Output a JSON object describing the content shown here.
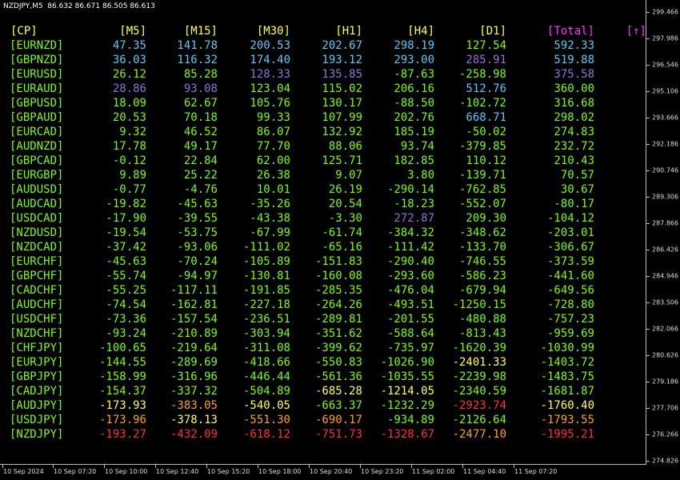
{
  "chart_title": "NZDJPY,M5  86.632 86.671 86.505 86.613",
  "price_axis": [
    "299.466",
    "297.986",
    "296.546",
    "295.106",
    "293.666",
    "292.186",
    "290.746",
    "289.306",
    "287.866",
    "286.426",
    "284.946",
    "283.506",
    "282.066",
    "280.626",
    "279.186",
    "277.706",
    "276.266",
    "274.826"
  ],
  "time_axis": [
    "10 Sep 2024",
    "10 Sep 07:20",
    "10 Sep 10:00",
    "10 Sep 12:40",
    "10 Sep 15:20",
    "10 Sep 18:00",
    "10 Sep 20:40",
    "10 Sep 23:20",
    "11 Sep 02:00",
    "11 Sep 04:40",
    "11 Sep 07:20"
  ],
  "table": {
    "headers": {
      "pair": "[CP]",
      "m5": "[M5]",
      "m15": "[M15]",
      "m30": "[M30]",
      "h1": "[H1]",
      "h4": "[H4]",
      "d1": "[D1]",
      "total": "[Total]",
      "sort": "[↑]"
    },
    "rows": [
      {
        "pair": "[EURNZD]",
        "values": [
          "47.35",
          "141.78",
          "200.53",
          "202.67",
          "298.19",
          "127.54",
          "592.33"
        ],
        "colors": [
          "#5ac8fa",
          "#5ac8fa",
          "#5ac8fa",
          "#5ac8fa",
          "#5ac8fa",
          "#7cfc00",
          "#5ac8fa"
        ]
      },
      {
        "pair": "[GBPNZD]",
        "values": [
          "36.03",
          "116.32",
          "174.40",
          "193.12",
          "293.00",
          "285.91",
          "519.88"
        ],
        "colors": [
          "#5ac8fa",
          "#5ac8fa",
          "#5ac8fa",
          "#5ac8fa",
          "#5ac8fa",
          "#9370db",
          "#5ac8fa"
        ]
      },
      {
        "pair": "[EURUSD]",
        "values": [
          "26.12",
          "85.28",
          "128.33",
          "135.85",
          "-87.63",
          "-258.98",
          "375.58"
        ],
        "colors": [
          "#7cfc00",
          "#7cfc00",
          "#9370db",
          "#9370db",
          "#7cfc00",
          "#7cfc00",
          "#9370db"
        ]
      },
      {
        "pair": "[EURAUD]",
        "values": [
          "28.86",
          "93.08",
          "123.04",
          "115.02",
          "206.16",
          "512.76",
          "360.00"
        ],
        "colors": [
          "#9370db",
          "#9370db",
          "#7cfc00",
          "#7cfc00",
          "#7cfc00",
          "#5ac8fa",
          "#7cfc00"
        ]
      },
      {
        "pair": "[GBPUSD]",
        "values": [
          "18.09",
          "62.67",
          "105.76",
          "130.17",
          "-88.50",
          "-102.72",
          "316.68"
        ],
        "colors": [
          "#7cfc00",
          "#7cfc00",
          "#7cfc00",
          "#7cfc00",
          "#7cfc00",
          "#7cfc00",
          "#7cfc00"
        ]
      },
      {
        "pair": "[GBPAUD]",
        "values": [
          "20.53",
          "70.18",
          "99.33",
          "107.99",
          "202.76",
          "668.71",
          "298.02"
        ],
        "colors": [
          "#7cfc00",
          "#7cfc00",
          "#7cfc00",
          "#7cfc00",
          "#7cfc00",
          "#5ac8fa",
          "#7cfc00"
        ]
      },
      {
        "pair": "[EURCAD]",
        "values": [
          "9.32",
          "46.52",
          "86.07",
          "132.92",
          "185.19",
          "-50.02",
          "274.83"
        ],
        "colors": [
          "#7cfc00",
          "#7cfc00",
          "#7cfc00",
          "#7cfc00",
          "#7cfc00",
          "#7cfc00",
          "#7cfc00"
        ]
      },
      {
        "pair": "[AUDNZD]",
        "values": [
          "17.78",
          "49.17",
          "77.70",
          "88.06",
          "93.74",
          "-379.85",
          "232.72"
        ],
        "colors": [
          "#7cfc00",
          "#7cfc00",
          "#7cfc00",
          "#7cfc00",
          "#7cfc00",
          "#7cfc00",
          "#7cfc00"
        ]
      },
      {
        "pair": "[GBPCAD]",
        "values": [
          "-0.12",
          "22.84",
          "62.00",
          "125.71",
          "182.85",
          "110.12",
          "210.43"
        ],
        "colors": [
          "#7cfc00",
          "#7cfc00",
          "#7cfc00",
          "#7cfc00",
          "#7cfc00",
          "#7cfc00",
          "#7cfc00"
        ]
      },
      {
        "pair": "[EURGBP]",
        "values": [
          "9.89",
          "25.22",
          "26.38",
          "9.07",
          "3.80",
          "-139.71",
          "70.57"
        ],
        "colors": [
          "#7cfc00",
          "#7cfc00",
          "#7cfc00",
          "#7cfc00",
          "#7cfc00",
          "#7cfc00",
          "#7cfc00"
        ]
      },
      {
        "pair": "[AUDUSD]",
        "values": [
          "-0.77",
          "-4.76",
          "10.01",
          "26.19",
          "-290.14",
          "-762.85",
          "30.67"
        ],
        "colors": [
          "#7cfc00",
          "#7cfc00",
          "#7cfc00",
          "#7cfc00",
          "#7cfc00",
          "#7cfc00",
          "#7cfc00"
        ]
      },
      {
        "pair": "[AUDCAD]",
        "values": [
          "-19.82",
          "-45.63",
          "-35.26",
          "20.54",
          "-18.23",
          "-552.07",
          "-80.17"
        ],
        "colors": [
          "#7cfc00",
          "#7cfc00",
          "#7cfc00",
          "#7cfc00",
          "#7cfc00",
          "#7cfc00",
          "#7cfc00"
        ]
      },
      {
        "pair": "[USDCAD]",
        "values": [
          "-17.90",
          "-39.55",
          "-43.38",
          "-3.30",
          "272.87",
          "209.30",
          "-104.12"
        ],
        "colors": [
          "#7cfc00",
          "#7cfc00",
          "#7cfc00",
          "#7cfc00",
          "#9370db",
          "#7cfc00",
          "#7cfc00"
        ]
      },
      {
        "pair": "[NZDUSD]",
        "values": [
          "-19.54",
          "-53.75",
          "-67.99",
          "-61.74",
          "-384.32",
          "-348.62",
          "-203.01"
        ],
        "colors": [
          "#7cfc00",
          "#7cfc00",
          "#7cfc00",
          "#7cfc00",
          "#7cfc00",
          "#7cfc00",
          "#7cfc00"
        ]
      },
      {
        "pair": "[NZDCAD]",
        "values": [
          "-37.42",
          "-93.06",
          "-111.02",
          "-65.16",
          "-111.42",
          "-133.70",
          "-306.67"
        ],
        "colors": [
          "#7cfc00",
          "#7cfc00",
          "#7cfc00",
          "#7cfc00",
          "#7cfc00",
          "#7cfc00",
          "#7cfc00"
        ]
      },
      {
        "pair": "[EURCHF]",
        "values": [
          "-45.63",
          "-70.24",
          "-105.89",
          "-151.83",
          "-290.40",
          "-746.55",
          "-373.59"
        ],
        "colors": [
          "#7cfc00",
          "#7cfc00",
          "#7cfc00",
          "#7cfc00",
          "#7cfc00",
          "#7cfc00",
          "#7cfc00"
        ]
      },
      {
        "pair": "[GBPCHF]",
        "values": [
          "-55.74",
          "-94.97",
          "-130.81",
          "-160.08",
          "-293.60",
          "-586.23",
          "-441.60"
        ],
        "colors": [
          "#7cfc00",
          "#7cfc00",
          "#7cfc00",
          "#7cfc00",
          "#7cfc00",
          "#7cfc00",
          "#7cfc00"
        ]
      },
      {
        "pair": "[CADCHF]",
        "values": [
          "-55.25",
          "-117.11",
          "-191.85",
          "-285.35",
          "-476.04",
          "-679.94",
          "-649.56"
        ],
        "colors": [
          "#7cfc00",
          "#7cfc00",
          "#7cfc00",
          "#7cfc00",
          "#7cfc00",
          "#7cfc00",
          "#7cfc00"
        ]
      },
      {
        "pair": "[AUDCHF]",
        "values": [
          "-74.54",
          "-162.81",
          "-227.18",
          "-264.26",
          "-493.51",
          "-1250.15",
          "-728.80"
        ],
        "colors": [
          "#7cfc00",
          "#7cfc00",
          "#7cfc00",
          "#7cfc00",
          "#7cfc00",
          "#7cfc00",
          "#7cfc00"
        ]
      },
      {
        "pair": "[USDCHF]",
        "values": [
          "-73.36",
          "-157.54",
          "-236.51",
          "-289.81",
          "-201.55",
          "-480.88",
          "-757.23"
        ],
        "colors": [
          "#7cfc00",
          "#7cfc00",
          "#7cfc00",
          "#7cfc00",
          "#7cfc00",
          "#7cfc00",
          "#7cfc00"
        ]
      },
      {
        "pair": "[NZDCHF]",
        "values": [
          "-93.24",
          "-210.89",
          "-303.94",
          "-351.62",
          "-588.64",
          "-813.43",
          "-959.69"
        ],
        "colors": [
          "#7cfc00",
          "#7cfc00",
          "#7cfc00",
          "#7cfc00",
          "#7cfc00",
          "#7cfc00",
          "#7cfc00"
        ]
      },
      {
        "pair": "[CHFJPY]",
        "values": [
          "-100.65",
          "-219.64",
          "-311.08",
          "-399.62",
          "-735.97",
          "-1620.39",
          "-1030.99"
        ],
        "colors": [
          "#7cfc00",
          "#7cfc00",
          "#7cfc00",
          "#7cfc00",
          "#7cfc00",
          "#7cfc00",
          "#7cfc00"
        ]
      },
      {
        "pair": "[EURJPY]",
        "values": [
          "-144.55",
          "-289.69",
          "-418.66",
          "-550.83",
          "-1026.90",
          "-2401.33",
          "-1403.72"
        ],
        "colors": [
          "#7cfc00",
          "#7cfc00",
          "#7cfc00",
          "#7cfc00",
          "#7cfc00",
          "#ffff4d",
          "#7cfc00"
        ]
      },
      {
        "pair": "[GBPJPY]",
        "values": [
          "-158.99",
          "-316.96",
          "-446.44",
          "-561.36",
          "-1035.55",
          "-2239.98",
          "-1483.75"
        ],
        "colors": [
          "#7cfc00",
          "#7cfc00",
          "#7cfc00",
          "#7cfc00",
          "#7cfc00",
          "#7cfc00",
          "#7cfc00"
        ]
      },
      {
        "pair": "[CADJPY]",
        "values": [
          "-154.37",
          "-337.32",
          "-504.89",
          "-685.28",
          "-1214.05",
          "-2340.59",
          "-1681.87"
        ],
        "colors": [
          "#7cfc00",
          "#7cfc00",
          "#7cfc00",
          "#ffff4d",
          "#ffff4d",
          "#7cfc00",
          "#7cfc00"
        ]
      },
      {
        "pair": "[AUDJPY]",
        "values": [
          "-173.93",
          "-383.05",
          "-540.05",
          "-663.37",
          "-1232.29",
          "-2923.74",
          "-1760.40"
        ],
        "colors": [
          "#ffff4d",
          "#ffa500",
          "#ffff4d",
          "#7cfc00",
          "#7cfc00",
          "#ff3030",
          "#ffff4d"
        ]
      },
      {
        "pair": "[USDJPY]",
        "values": [
          "-173.96",
          "-378.13",
          "-551.30",
          "-690.17",
          "-934.89",
          "-2126.64",
          "-1793.55"
        ],
        "colors": [
          "#ffa500",
          "#ffff4d",
          "#ffa500",
          "#ffa500",
          "#7cfc00",
          "#7cfc00",
          "#ffa500"
        ]
      },
      {
        "pair": "[NZDJPY]",
        "values": [
          "-193.27",
          "-432.09",
          "-618.12",
          "-751.73",
          "-1328.67",
          "-2477.10",
          "-1995.21"
        ],
        "colors": [
          "#ff3030",
          "#ff3030",
          "#ff3030",
          "#ff3030",
          "#ff3030",
          "#ffa500",
          "#ff3030"
        ]
      }
    ]
  }
}
